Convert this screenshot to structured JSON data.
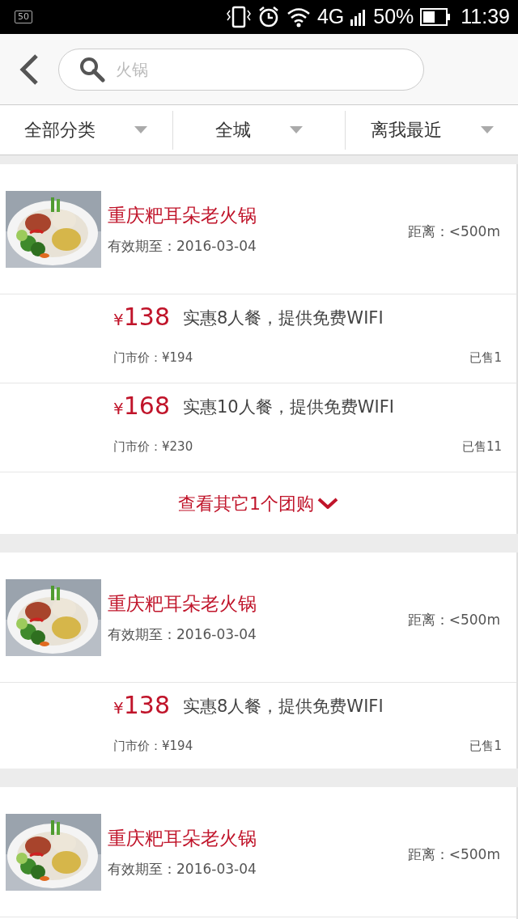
{
  "status_bar": {
    "sim_badge": "50",
    "network": "4G",
    "battery": "50%",
    "time": "11:39"
  },
  "search": {
    "placeholder": "火锅"
  },
  "filters": [
    {
      "label": "全部分类"
    },
    {
      "label": "全城"
    },
    {
      "label": "离我最近"
    }
  ],
  "shops": [
    {
      "kind": "picture",
      "name": "重庆粑耳朵老火锅",
      "valid_until": "有效期至：2016-03-04",
      "distance": "距离：<500m",
      "deals": [
        {
          "currency": "¥",
          "amount": "138",
          "description": "实惠8人餐，提供免费WIFI",
          "market_price": "门市价：¥194",
          "sold": "已售1"
        },
        {
          "currency": "¥",
          "amount": "168",
          "description": "实惠10人餐，提供免费WIFI",
          "market_price": "门市价：¥230",
          "sold": "已售11"
        }
      ],
      "more_link": "查看其它1个团购"
    },
    {
      "kind": "picture",
      "name": "重庆粑耳朵老火锅",
      "valid_until": "有效期至：2016-03-04",
      "distance": "距离：<500m",
      "deals": [
        {
          "currency": "¥",
          "amount": "138",
          "description": "实惠8人餐，提供免费WIFI",
          "market_price": "门市价：¥194",
          "sold": "已售1"
        }
      ]
    },
    {
      "kind": "picture",
      "name": "重庆粑耳朵老火锅",
      "valid_until": "有效期至：2016-03-04",
      "distance": "距离：<500m"
    }
  ]
}
